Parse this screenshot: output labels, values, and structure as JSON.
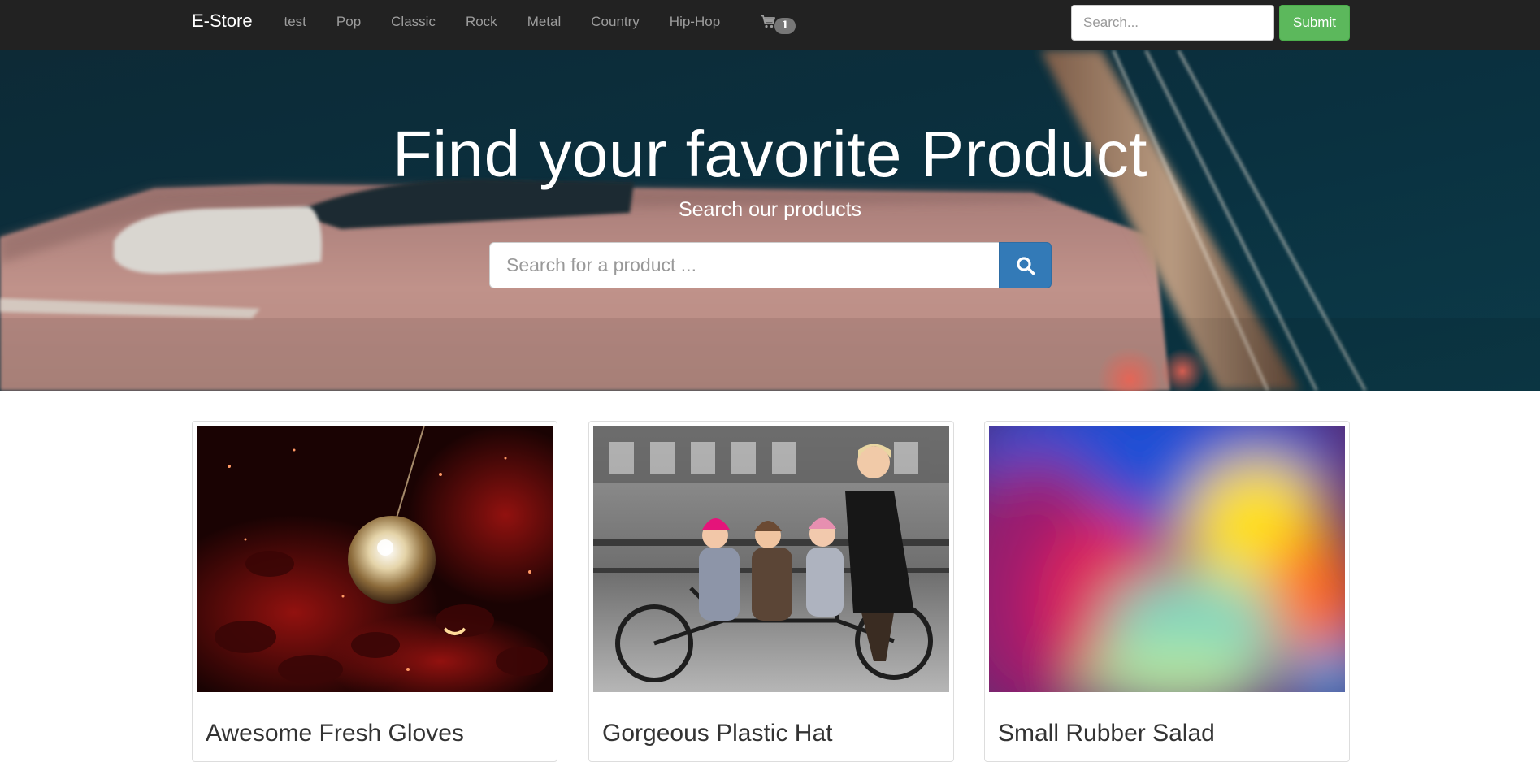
{
  "navbar": {
    "brand": "E-Store",
    "links": [
      "test",
      "Pop",
      "Classic",
      "Rock",
      "Metal",
      "Country",
      "Hip-Hop"
    ],
    "cart": {
      "icon": "shopping-cart-icon",
      "count": "1"
    },
    "search": {
      "placeholder": "Search...",
      "value": ""
    },
    "submit_label": "Submit"
  },
  "hero": {
    "title": "Find your favorite Product",
    "subtitle": "Search our products",
    "search": {
      "placeholder": "Search for a product ...",
      "value": ""
    },
    "search_button_icon": "search-icon"
  },
  "products": [
    {
      "name": "Awesome Fresh Gloves"
    },
    {
      "name": "Gorgeous Plastic Hat"
    },
    {
      "name": "Small Rubber Salad"
    }
  ],
  "colors": {
    "navbar_bg": "#222222",
    "nav_link": "#9d9d9d",
    "submit_green": "#5cb85c",
    "search_blue": "#337ab7",
    "badge_gray": "#777777"
  }
}
